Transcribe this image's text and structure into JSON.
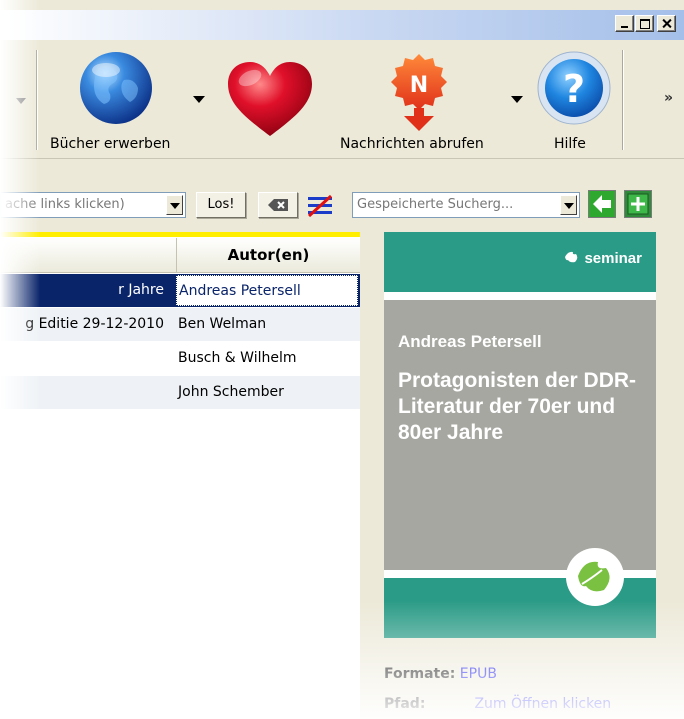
{
  "window": {
    "controls": {
      "minimize": "minimize",
      "maximize": "maximize",
      "close": "close"
    }
  },
  "toolbar": {
    "buy_books_label": "Bücher erwerben",
    "fetch_news_label": "Nachrichten abrufen",
    "help_label": "Hilfe",
    "news_icon_letter": "N",
    "more_label": "»"
  },
  "search": {
    "query_text": "ache links klicken)",
    "go_label": "Los!",
    "saved_searches_placeholder": "Gespeicherte Sucherg..."
  },
  "table": {
    "author_header": "Autor(en)",
    "rows": [
      {
        "title": "r Jahre",
        "author": "Andreas Petersell",
        "selected": true
      },
      {
        "title": "g Editie 29-12-2010",
        "author": "Ben Welman",
        "selected": false
      },
      {
        "title": "",
        "author": "Busch & Wilhelm",
        "selected": false
      },
      {
        "title": "",
        "author": "John Schember",
        "selected": false
      }
    ]
  },
  "details": {
    "cover": {
      "brand": "seminar",
      "author": "Andreas Petersell",
      "title": "Protagonisten der DDR-Literatur der 70er und 80er Jahre"
    },
    "formats_label": "Formate:",
    "formats_value": "EPUB",
    "path_label": "Pfad:",
    "path_value": "Zum Öffnen klicken"
  },
  "colors": {
    "selection": "#0a246a",
    "cover_teal": "#2a9b86",
    "cover_gray": "#a7a7a1",
    "accent_yellow": "#ffee00",
    "link": "#0000ee"
  }
}
